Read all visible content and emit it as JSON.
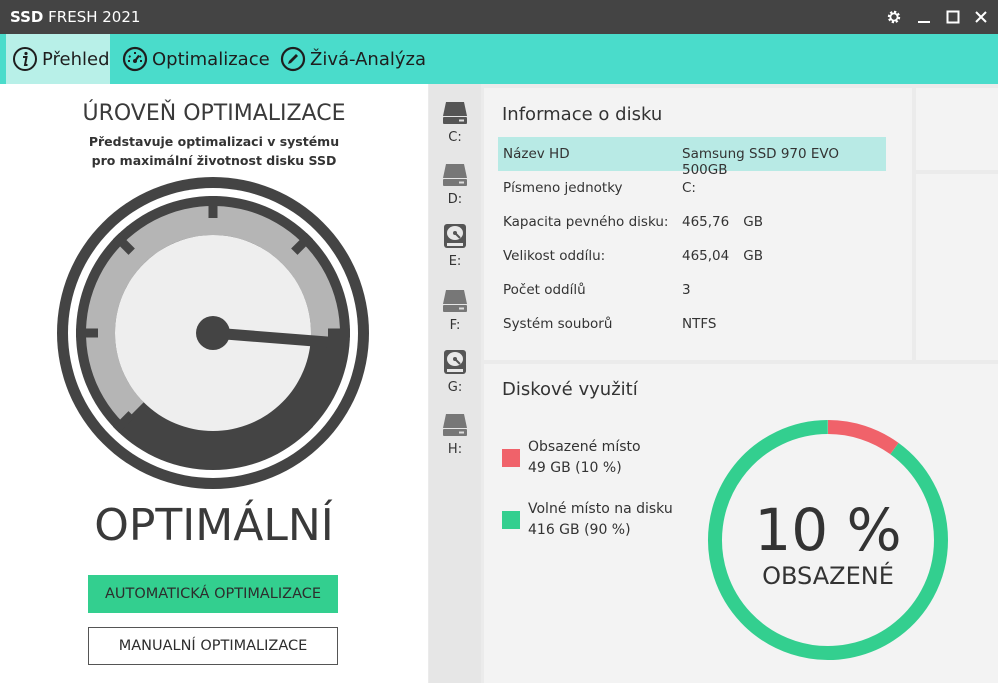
{
  "window": {
    "title_bold": "SSD",
    "title_rest": "FRESH 2021"
  },
  "tabs": [
    {
      "label": "Přehled",
      "icon": "info-icon"
    },
    {
      "label": "Optimalizace",
      "icon": "speedometer-icon"
    },
    {
      "label": "Živá-Analýza",
      "icon": "pencil-icon"
    }
  ],
  "left": {
    "title": "ÚROVEŇ OPTIMALIZACE",
    "subtitle": "Představuje optimalizaci v systému pro maximální životnost disku SSD",
    "status": "OPTIMÁLNÍ",
    "auto_button": "AUTOMATICKÁ OPTIMALIZACE",
    "manual_button": "MANUALNÍ OPTIMALIZACE",
    "gauge_level": 0.85
  },
  "drives": [
    {
      "label": "C:",
      "icon": "ssd-drive-icon"
    },
    {
      "label": "D:",
      "icon": "hdd-drive-icon"
    },
    {
      "label": "E:",
      "icon": "disk-platter-icon"
    },
    {
      "label": "F:",
      "icon": "hdd-drive-icon"
    },
    {
      "label": "G:",
      "icon": "disk-platter-icon"
    },
    {
      "label": "H:",
      "icon": "hdd-drive-icon"
    }
  ],
  "disk_info": {
    "title": "Informace o disku",
    "rows": [
      {
        "key": "Název HD",
        "value": "Samsung SSD 970 EVO 500GB",
        "unit": ""
      },
      {
        "key": "Písmeno jednotky",
        "value": "C:",
        "unit": ""
      },
      {
        "key": "Kapacita pevného disku:",
        "value": "465,76",
        "unit": "GB"
      },
      {
        "key": "Velikost oddílu:",
        "value": "465,04",
        "unit": "GB"
      },
      {
        "key": "Počet oddílů",
        "value": "3",
        "unit": ""
      },
      {
        "key": "Systém souborů",
        "value": "NTFS",
        "unit": ""
      }
    ]
  },
  "usage": {
    "title": "Diskové využití",
    "used_label": "Obsazené místo",
    "used_value": "49 GB (10 %)",
    "free_label": "Volné místo na disku",
    "free_value": "416 GB (90 %)",
    "percent_text": "10 %",
    "percent_caption": "OBSAZENÉ",
    "used_fraction": 0.1,
    "colors": {
      "used": "#f0626a",
      "free": "#33cf8f"
    }
  }
}
